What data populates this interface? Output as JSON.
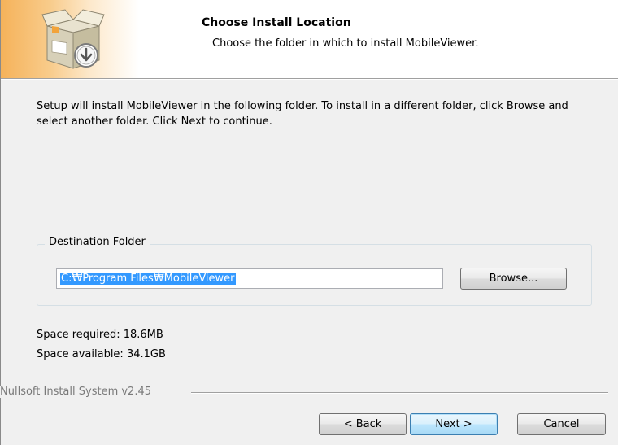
{
  "header": {
    "title": "Choose Install Location",
    "subtitle": "Choose the folder in which to install MobileViewer."
  },
  "description": "Setup will install MobileViewer in the following folder. To install in a different folder, click Browse and select another folder. Click Next to continue.",
  "destination": {
    "label": "Destination Folder",
    "path": "C:₩Program Files₩MobileViewer",
    "browse_label": "Browse..."
  },
  "space": {
    "required": "Space required: 18.6MB",
    "available": "Space available: 34.1GB"
  },
  "branding": "Nullsoft Install System v2.45",
  "buttons": {
    "back": "< Back",
    "next": "Next >",
    "cancel": "Cancel"
  },
  "icons": {
    "header_icon": "install-box-icon"
  },
  "colors": {
    "header_gradient": "#f5b25a",
    "selection": "#3399ff",
    "default_button_border": "#3c7fb1"
  }
}
